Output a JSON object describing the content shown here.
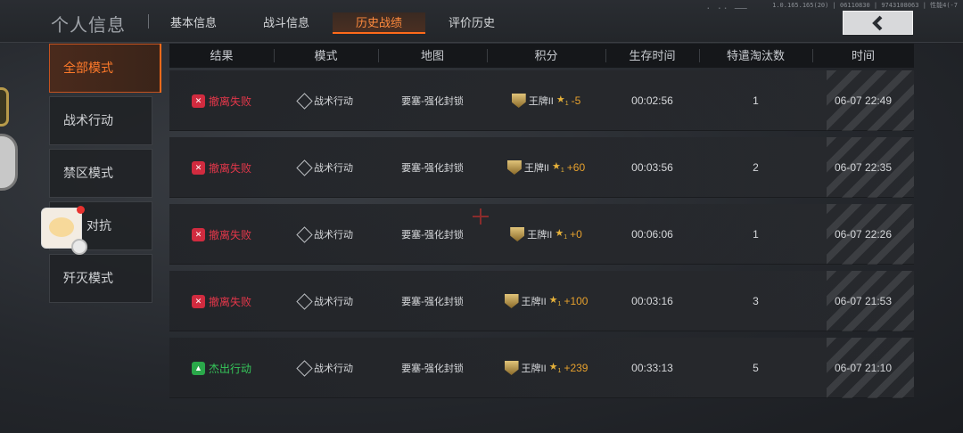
{
  "header": {
    "title": "个人信息",
    "tabs": [
      {
        "label": "基本信息",
        "active": false
      },
      {
        "label": "战斗信息",
        "active": false
      },
      {
        "label": "历史战绩",
        "active": true
      },
      {
        "label": "评价历史",
        "active": false
      }
    ],
    "sysinfo": "1.0.165.165(20) | 06110830 | 9743108063 | 性能4(-7",
    "scratch": "·  ··  —"
  },
  "nav": {
    "items": [
      {
        "label": "全部模式",
        "active": true
      },
      {
        "label": "战术行动",
        "active": false
      },
      {
        "label": "禁区模式",
        "active": false
      },
      {
        "label": "对抗",
        "active": false
      },
      {
        "label": "歼灭模式",
        "active": false
      }
    ]
  },
  "table": {
    "headers": [
      "结果",
      "模式",
      "地图",
      "积分",
      "生存时间",
      "特遣淘汰数",
      "时间"
    ],
    "rows": [
      {
        "result": "撤离失败",
        "result_type": "fail",
        "mode": "战术行动",
        "map": "要塞-强化封锁",
        "rank": "王牌II",
        "stars": "★",
        "star_sub": "1",
        "delta": "-5",
        "survival": "00:02:56",
        "kills": "1",
        "time": "06-07 22:49"
      },
      {
        "result": "撤离失败",
        "result_type": "fail",
        "mode": "战术行动",
        "map": "要塞-强化封锁",
        "rank": "王牌II",
        "stars": "★",
        "star_sub": "1",
        "delta": "+60",
        "survival": "00:03:56",
        "kills": "2",
        "time": "06-07 22:35"
      },
      {
        "result": "撤离失败",
        "result_type": "fail",
        "mode": "战术行动",
        "map": "要塞-强化封锁",
        "rank": "王牌II",
        "stars": "★",
        "star_sub": "1",
        "delta": "+0",
        "survival": "00:06:06",
        "kills": "1",
        "time": "06-07 22:26"
      },
      {
        "result": "撤离失败",
        "result_type": "fail",
        "mode": "战术行动",
        "map": "要塞-强化封锁",
        "rank": "王牌II",
        "stars": "★",
        "star_sub": "1",
        "delta": "+100",
        "survival": "00:03:16",
        "kills": "3",
        "time": "06-07 21:53"
      },
      {
        "result": "杰出行动",
        "result_type": "win",
        "mode": "战术行动",
        "map": "要塞-强化封锁",
        "rank": "王牌II",
        "stars": "★",
        "star_sub": "1",
        "delta": "+239",
        "survival": "00:33:13",
        "kills": "5",
        "time": "06-07 21:10"
      }
    ]
  },
  "icons": {
    "back": "back-arrow-icon",
    "fail": "fail-icon",
    "win": "win-flame-icon",
    "mode": "mode-diamond-icon",
    "rank": "rank-badge-icon"
  },
  "colors": {
    "accent": "#ff6a1a",
    "fail": "#e4374a",
    "win": "#36c85a",
    "delta": "#e6a02d"
  }
}
